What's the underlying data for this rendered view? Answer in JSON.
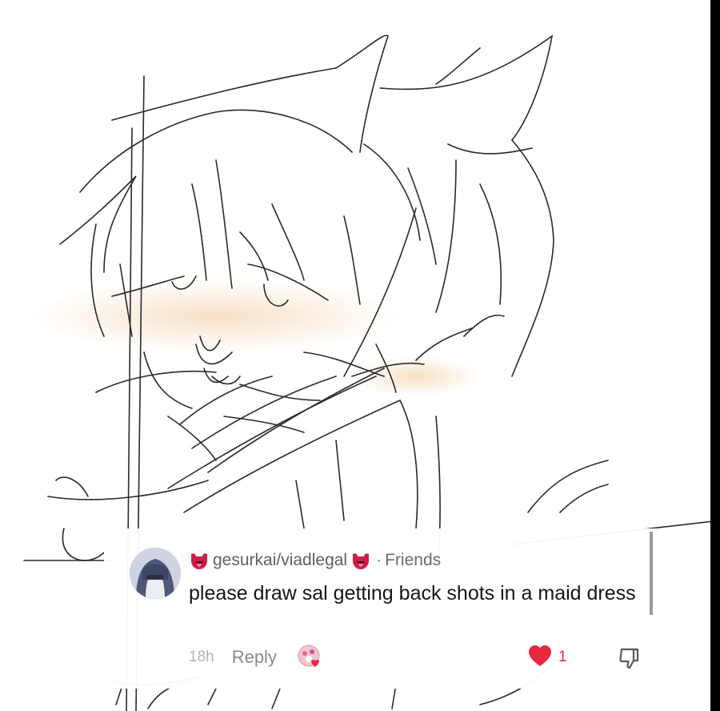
{
  "comment": {
    "username": "gesurkai/viadlegal",
    "separator": "·",
    "relation": "Friends",
    "text": "please draw sal getting back shots in a maid dress",
    "time": "18h",
    "reply_label": "Reply",
    "like_count": "1",
    "icons": {
      "username_left": "tongue-emoji-icon",
      "username_right": "tongue-emoji-icon",
      "creator_like": "creator-avatar-heart-icon",
      "like": "heart-icon",
      "dislike": "thumbs-down-icon"
    }
  },
  "colors": {
    "like_red": "#e8283e",
    "sketch_stroke": "#2a2a2a",
    "blush": "#f5d9b8"
  }
}
